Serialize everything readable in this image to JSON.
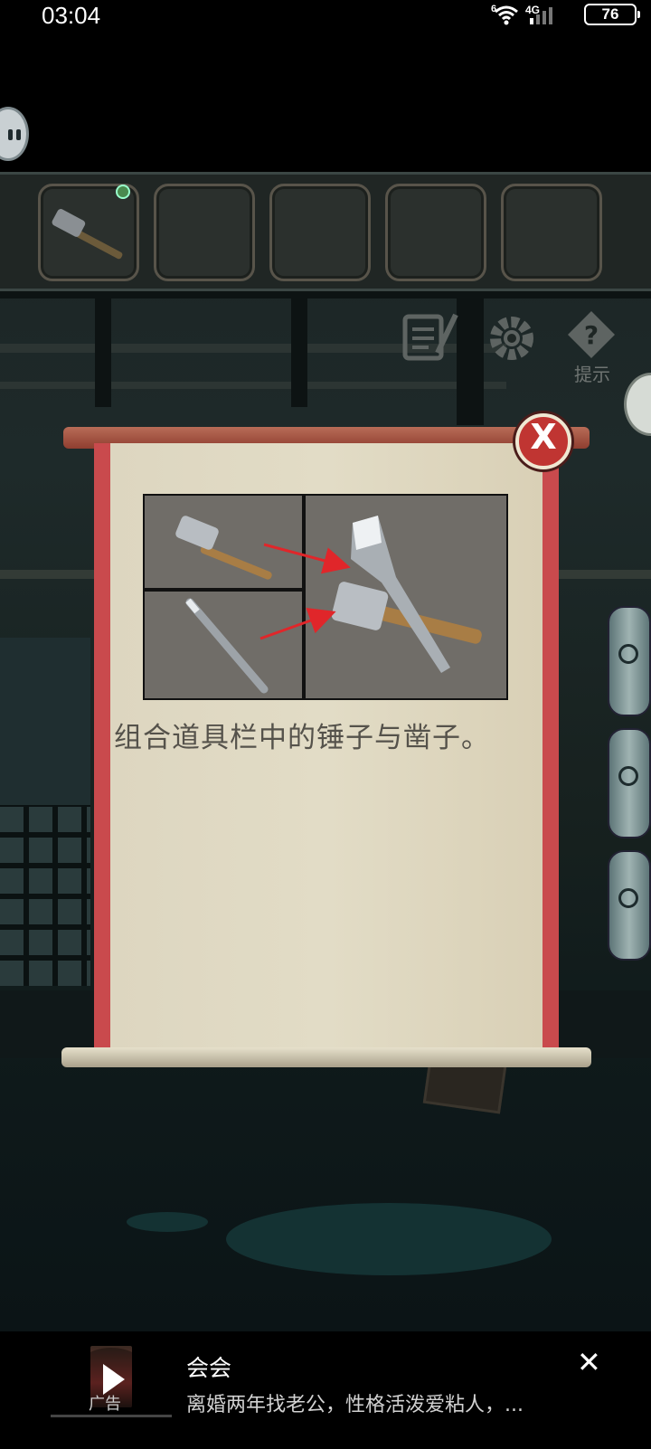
{
  "status_bar": {
    "time": "03:04",
    "battery": "76",
    "network": "4G",
    "sim": "6"
  },
  "inventory": {
    "slots": [
      "hammer",
      "",
      "",
      "",
      ""
    ]
  },
  "toolbar": {
    "hint_label": "提示"
  },
  "hint_dialog": {
    "close_label": "X",
    "text": "组合道具栏中的锤子与凿子。"
  },
  "ad": {
    "title": "会会",
    "description": "离婚两年找老公，性格活泼爱粘人，...",
    "tag": "广告",
    "close_label": "✕"
  },
  "colors": {
    "scroll_border": "#c94a4d",
    "scroll_paper": "#ddd6c0",
    "close_button": "#c03532",
    "arrow": "#e0262a"
  }
}
